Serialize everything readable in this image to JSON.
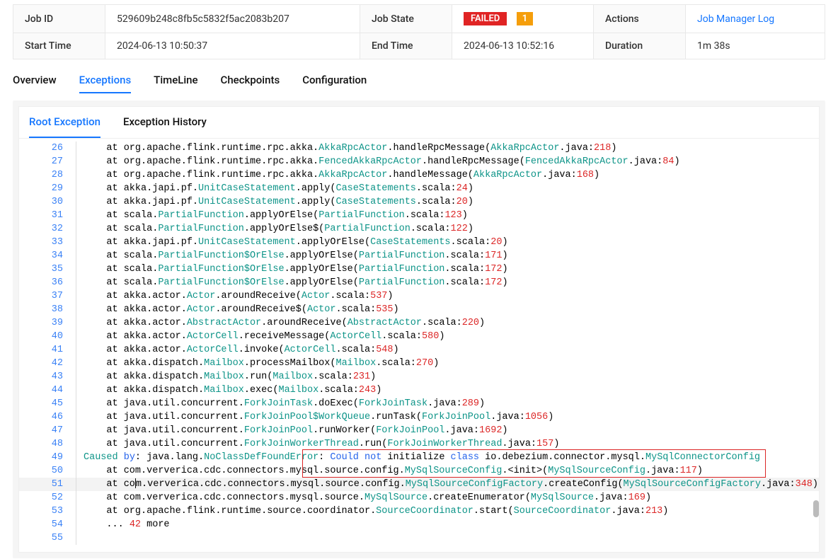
{
  "info": {
    "jobIdLabel": "Job ID",
    "jobId": "529609b248c8fb5c5832f5ac2083b207",
    "jobStateLabel": "Job State",
    "jobStateBadge": "FAILED",
    "jobStateCount": "1",
    "actionsLabel": "Actions",
    "actionsLink": "Job Manager Log",
    "startTimeLabel": "Start Time",
    "startTime": "2024-06-13 10:50:37",
    "endTimeLabel": "End Time",
    "endTime": "2024-06-13 10:52:16",
    "durationLabel": "Duration",
    "duration": "1m 38s"
  },
  "tabs": {
    "overview": "Overview",
    "exceptions": "Exceptions",
    "timeline": "TimeLine",
    "checkpoints": "Checkpoints",
    "configuration": "Configuration"
  },
  "subtabs": {
    "root": "Root Exception",
    "history": "Exception History"
  },
  "stack": [
    {
      "n": 26,
      "html": "    at org.apache.flink.runtime.rpc.akka.<span class='tok-type'>AkkaRpcActor</span>.handleRpcMessage(<span class='tok-type'>AkkaRpcActor</span>.java:<span class='tok-num'>218</span>)"
    },
    {
      "n": 27,
      "html": "    at org.apache.flink.runtime.rpc.akka.<span class='tok-type'>FencedAkkaRpcActor</span>.handleRpcMessage(<span class='tok-type'>FencedAkkaRpcActor</span>.java:<span class='tok-num'>84</span>)"
    },
    {
      "n": 28,
      "html": "    at org.apache.flink.runtime.rpc.akka.<span class='tok-type'>AkkaRpcActor</span>.handleMessage(<span class='tok-type'>AkkaRpcActor</span>.java:<span class='tok-num'>168</span>)"
    },
    {
      "n": 29,
      "html": "    at akka.japi.pf.<span class='tok-type'>UnitCaseStatement</span>.apply(<span class='tok-type'>CaseStatements</span>.scala:<span class='tok-num'>24</span>)"
    },
    {
      "n": 30,
      "html": "    at akka.japi.pf.<span class='tok-type'>UnitCaseStatement</span>.apply(<span class='tok-type'>CaseStatements</span>.scala:<span class='tok-num'>20</span>)"
    },
    {
      "n": 31,
      "html": "    at scala.<span class='tok-type'>PartialFunction</span>.applyOrElse(<span class='tok-type'>PartialFunction</span>.scala:<span class='tok-num'>123</span>)"
    },
    {
      "n": 32,
      "html": "    at scala.<span class='tok-type'>PartialFunction</span>.applyOrElse$(<span class='tok-type'>PartialFunction</span>.scala:<span class='tok-num'>122</span>)"
    },
    {
      "n": 33,
      "html": "    at akka.japi.pf.<span class='tok-type'>UnitCaseStatement</span>.applyOrElse(<span class='tok-type'>CaseStatements</span>.scala:<span class='tok-num'>20</span>)"
    },
    {
      "n": 34,
      "html": "    at scala.<span class='tok-type'>PartialFunction$OrElse</span>.applyOrElse(<span class='tok-type'>PartialFunction</span>.scala:<span class='tok-num'>171</span>)"
    },
    {
      "n": 35,
      "html": "    at scala.<span class='tok-type'>PartialFunction$OrElse</span>.applyOrElse(<span class='tok-type'>PartialFunction</span>.scala:<span class='tok-num'>172</span>)"
    },
    {
      "n": 36,
      "html": "    at scala.<span class='tok-type'>PartialFunction$OrElse</span>.applyOrElse(<span class='tok-type'>PartialFunction</span>.scala:<span class='tok-num'>172</span>)"
    },
    {
      "n": 37,
      "html": "    at akka.actor.<span class='tok-type'>Actor</span>.aroundReceive(<span class='tok-type'>Actor</span>.scala:<span class='tok-num'>537</span>)"
    },
    {
      "n": 38,
      "html": "    at akka.actor.<span class='tok-type'>Actor</span>.aroundReceive$(<span class='tok-type'>Actor</span>.scala:<span class='tok-num'>535</span>)"
    },
    {
      "n": 39,
      "html": "    at akka.actor.<span class='tok-type'>AbstractActor</span>.aroundReceive(<span class='tok-type'>AbstractActor</span>.scala:<span class='tok-num'>220</span>)"
    },
    {
      "n": 40,
      "html": "    at akka.actor.<span class='tok-type'>ActorCell</span>.receiveMessage(<span class='tok-type'>ActorCell</span>.scala:<span class='tok-num'>580</span>)"
    },
    {
      "n": 41,
      "html": "    at akka.actor.<span class='tok-type'>ActorCell</span>.invoke(<span class='tok-type'>ActorCell</span>.scala:<span class='tok-num'>548</span>)"
    },
    {
      "n": 42,
      "html": "    at akka.dispatch.<span class='tok-type'>Mailbox</span>.processMailbox(<span class='tok-type'>Mailbox</span>.scala:<span class='tok-num'>270</span>)"
    },
    {
      "n": 43,
      "html": "    at akka.dispatch.<span class='tok-type'>Mailbox</span>.run(<span class='tok-type'>Mailbox</span>.scala:<span class='tok-num'>231</span>)"
    },
    {
      "n": 44,
      "html": "    at akka.dispatch.<span class='tok-type'>Mailbox</span>.exec(<span class='tok-type'>Mailbox</span>.scala:<span class='tok-num'>243</span>)"
    },
    {
      "n": 45,
      "html": "    at java.util.concurrent.<span class='tok-type'>ForkJoinTask</span>.doExec(<span class='tok-type'>ForkJoinTask</span>.java:<span class='tok-num'>289</span>)"
    },
    {
      "n": 46,
      "html": "    at java.util.concurrent.<span class='tok-type'>ForkJoinPool$WorkQueue</span>.runTask(<span class='tok-type'>ForkJoinPool</span>.java:<span class='tok-num'>1056</span>)"
    },
    {
      "n": 47,
      "html": "    at java.util.concurrent.<span class='tok-type'>ForkJoinPool</span>.runWorker(<span class='tok-type'>ForkJoinPool</span>.java:<span class='tok-num'>1692</span>)"
    },
    {
      "n": 48,
      "html": "    at java.util.concurrent.<span class='tok-type'>ForkJoinWorkerThread</span>.run(<span class='tok-type'>ForkJoinWorkerThread</span>.java:<span class='tok-num'>157</span>)"
    },
    {
      "n": 49,
      "html": "<span class='tok-type'>Caused</span> <span class='tok-kw'>by</span>: java.lang.<span class='tok-type'>NoClassDefFoundError</span>: <span class='tok-kw'>Could</span> <span class='tok-kw'>not</span> initialize <span class='tok-kw'>class</span> io.debezium.connector.mysql.<span class='tok-type'>MySqlConnectorConfig</span>"
    },
    {
      "n": 50,
      "html": "    at com.ververica.cdc.connectors.mysql.source.config.<span class='tok-type'>MySqlSourceConfig</span>.&lt;init&gt;(<span class='tok-type'>MySqlSourceConfig</span>.java:<span class='tok-num'>117</span>)"
    },
    {
      "n": 51,
      "current": true,
      "html": "    at co<span class='caret'></span>m.ververica.cdc.connectors.mysql.source.config.<span class='tok-type'>MySqlSourceConfigFactory</span>.createConfig(<span class='tok-type'>MySqlSourceConfigFactory</span>.java:<span class='tok-num'>348</span>)"
    },
    {
      "n": 52,
      "html": "    at com.ververica.cdc.connectors.mysql.source.<span class='tok-type'>MySqlSource</span>.createEnumerator(<span class='tok-type'>MySqlSource</span>.java:<span class='tok-num'>169</span>)"
    },
    {
      "n": 53,
      "html": "    at org.apache.flink.runtime.source.coordinator.<span class='tok-type'>SourceCoordinator</span>.start(<span class='tok-type'>SourceCoordinator</span>.java:<span class='tok-num'>213</span>)"
    },
    {
      "n": 54,
      "html": "    ... <span class='tok-num'>42</span> more"
    },
    {
      "n": 55,
      "html": ""
    }
  ]
}
